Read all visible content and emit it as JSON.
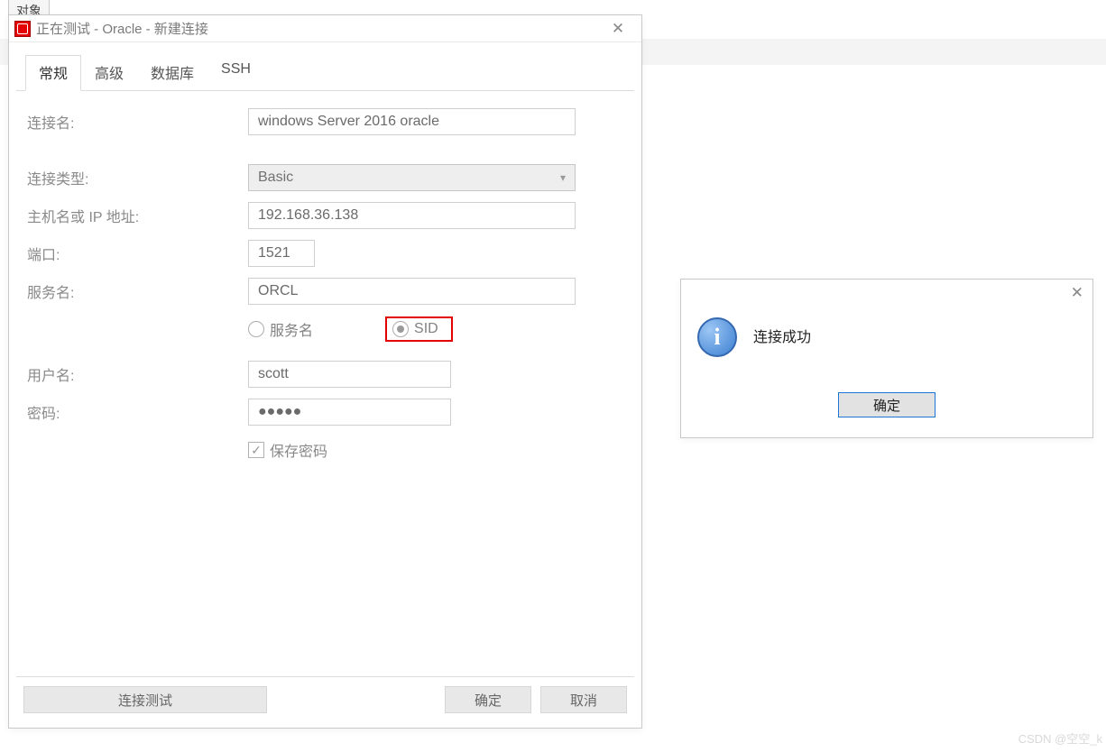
{
  "background_tab": "对象",
  "dialog": {
    "title": "正在测试 - Oracle - 新建连接",
    "tabs": [
      "常规",
      "高级",
      "数据库",
      "SSH"
    ],
    "active_tab": 0,
    "labels": {
      "conn_name": "连接名:",
      "conn_type": "连接类型:",
      "host": "主机名或 IP 地址:",
      "port": "端口:",
      "service": "服务名:",
      "username": "用户名:",
      "password": "密码:"
    },
    "values": {
      "conn_name": "windows Server 2016 oracle",
      "conn_type": "Basic",
      "host": "192.168.36.138",
      "port": "1521",
      "service": "ORCL",
      "username": "scott",
      "password": "●●●●●"
    },
    "radio": {
      "service_name": "服务名",
      "sid": "SID",
      "selected": "sid"
    },
    "save_password": "保存密码",
    "buttons": {
      "test": "连接测试",
      "ok": "确定",
      "cancel": "取消"
    }
  },
  "msgbox": {
    "text": "连接成功",
    "ok": "确定"
  },
  "watermark": "CSDN @空空_k"
}
